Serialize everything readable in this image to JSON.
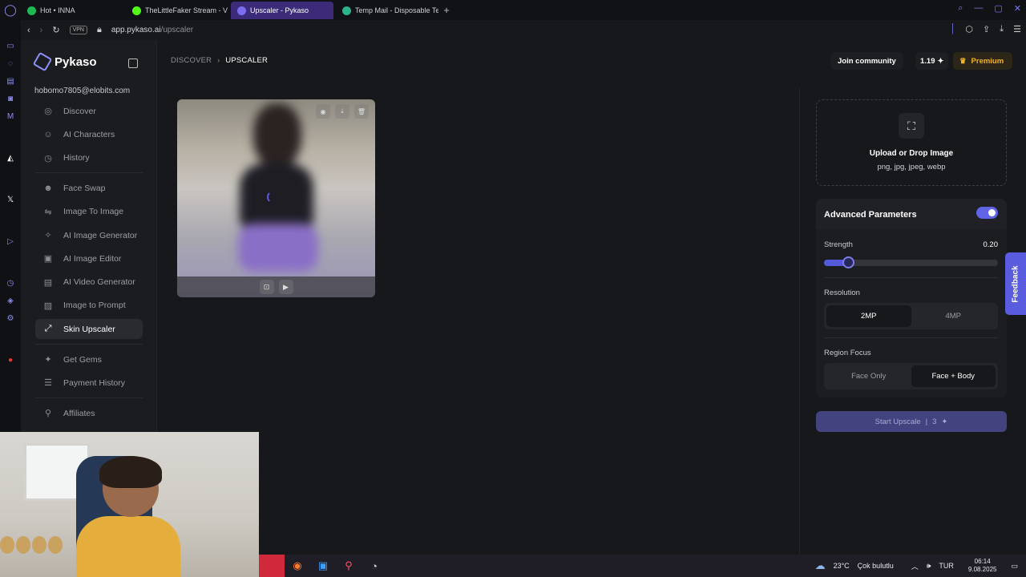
{
  "browser": {
    "tabs": [
      {
        "title": "Hot • INNA",
        "color": "#1db954",
        "active": false
      },
      {
        "title": "TheLittleFaker Stream - V",
        "color": "#53fc18",
        "active": false
      },
      {
        "title": "Upscaler - Pykaso",
        "color": "#7b6cf0",
        "active": true
      },
      {
        "title": "Temp Mail - Disposable Te",
        "color": "#2bb38a",
        "active": false
      }
    ],
    "vpn_label": "VPN",
    "url_host": "app.pykaso.ai",
    "url_path": "/upscaler"
  },
  "sidebar": {
    "brand": "Pykaso",
    "email": "hobomo7805@elobits.com",
    "groups": [
      [
        {
          "label": "Discover",
          "icon": "compass-icon",
          "glyph": "◎"
        },
        {
          "label": "AI Characters",
          "icon": "smiley-icon",
          "glyph": "☺"
        },
        {
          "label": "History",
          "icon": "clock-icon",
          "glyph": "◷"
        }
      ],
      [
        {
          "label": "Face Swap",
          "icon": "face-swap-icon",
          "glyph": "☻"
        },
        {
          "label": "Image To Image",
          "icon": "arrows-icon",
          "glyph": "⇋"
        },
        {
          "label": "AI Image Generator",
          "icon": "sparkle-icon",
          "glyph": "✧"
        },
        {
          "label": "AI Image Editor",
          "icon": "image-edit-icon",
          "glyph": "▣"
        },
        {
          "label": "AI Video Generator",
          "icon": "video-icon",
          "glyph": "▤"
        },
        {
          "label": "Image to Prompt",
          "icon": "image-prompt-icon",
          "glyph": "▨"
        },
        {
          "label": "Skin Upscaler",
          "icon": "upscale-icon",
          "glyph": "⤢",
          "active": true
        }
      ],
      [
        {
          "label": "Get Gems",
          "icon": "gem-icon",
          "glyph": "✦"
        },
        {
          "label": "Payment History",
          "icon": "payment-icon",
          "glyph": "☰"
        }
      ],
      [
        {
          "label": "Affiliates",
          "icon": "affiliate-icon",
          "glyph": "⚲"
        }
      ]
    ]
  },
  "header": {
    "breadcrumb_root": "DISCOVER",
    "breadcrumb_sep": "›",
    "breadcrumb_current": "UPSCALER",
    "join_label": "Join community",
    "gems_count": "1.19",
    "premium_label": "Premium"
  },
  "upload": {
    "title": "Upload or Drop Image",
    "formats": "png, jpg, jpeg, webp"
  },
  "advanced": {
    "title": "Advanced Parameters",
    "enabled": true,
    "strength_label": "Strength",
    "strength_value": "0.20",
    "strength_level": 0.14,
    "resolution_label": "Resolution",
    "resolution_options": [
      "2MP",
      "4MP"
    ],
    "resolution_selected": "2MP",
    "region_label": "Region Focus",
    "region_options": [
      "Face Only",
      "Face + Body"
    ],
    "region_selected": "Face + Body"
  },
  "start": {
    "label": "Start Upscale",
    "sep": "|",
    "cost": "3"
  },
  "feedback_label": "Feedback",
  "taskbar": {
    "weather_temp": "23°C",
    "weather_desc": "Çok bulutlu",
    "lang": "TUR",
    "time": "06:14",
    "date": "9.08.2025"
  },
  "colors": {
    "accent": "#6164e6",
    "premium": "#f0b429",
    "background": "#17181c"
  }
}
